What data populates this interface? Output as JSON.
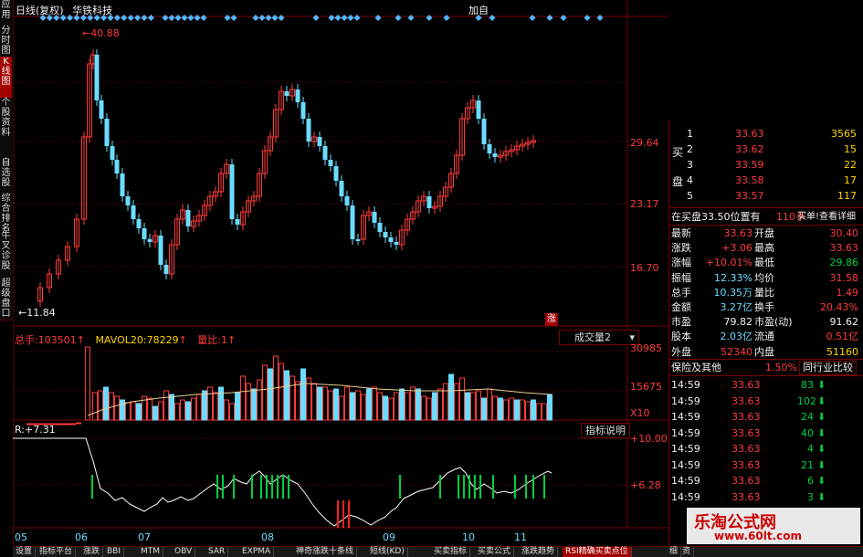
{
  "left_nav": [
    {
      "label": "应用",
      "active": false
    },
    {
      "label": "分时图",
      "active": false
    },
    {
      "label": "K线图",
      "active": true
    },
    {
      "label": "个股资料",
      "active": false
    },
    {
      "label": "自选股",
      "active": false
    },
    {
      "label": "综合排名",
      "active": false
    },
    {
      "label": "牛叉诊股",
      "active": false
    },
    {
      "label": "超级盘口",
      "active": false
    }
  ],
  "chart_header": {
    "period_label": "日线(复权)",
    "stock_name": "华铁科技",
    "right_label": "加自"
  },
  "price_panel": {
    "high_marker": "40.88",
    "low_marker": "11.84",
    "axis_ticks": [
      "29.64",
      "23.17",
      "16.70"
    ]
  },
  "volume_panel": {
    "total_label": "总手:",
    "total_value": "103501",
    "mavol_label": "MAVOL20:",
    "mavol_value": "78229",
    "ratio_label": "量比:",
    "ratio_value": "1",
    "dropdown_value": "成交量2",
    "zhang_badge": "涨",
    "axis_ticks": [
      "30985",
      "15675"
    ],
    "axis_unit": "X10"
  },
  "indicator_panel": {
    "r_label": "R:",
    "r_value": "+7.31",
    "button_label": "指标说明",
    "axis_ticks": [
      "+10.00",
      "+6.28"
    ]
  },
  "x_axis_months": [
    "05",
    "06",
    "07",
    "08",
    "09",
    "10",
    "11"
  ],
  "order_book": {
    "buy_label_1": "买",
    "buy_label_2": "盘",
    "levels": [
      {
        "level": "1",
        "price": "33.63",
        "volume": "3565"
      },
      {
        "level": "2",
        "price": "33.62",
        "volume": "15"
      },
      {
        "level": "3",
        "price": "33.59",
        "volume": "22"
      },
      {
        "level": "4",
        "price": "33.58",
        "volume": "17"
      },
      {
        "level": "5",
        "price": "33.57",
        "volume": "117"
      }
    ],
    "status_text": "在买盘33.50位置有",
    "status_count": "110手",
    "status_link": "买单!查看详细"
  },
  "quote": [
    {
      "l1": "最新",
      "v1": "33.63",
      "l2": "开盘",
      "v2": "30.40"
    },
    {
      "l1": "涨跌",
      "v1": "+3.06",
      "l2": "最高",
      "v2": "33.63"
    },
    {
      "l1": "涨幅",
      "v1": "+10.01%",
      "l2": "最低",
      "v2": "29.86"
    },
    {
      "l1": "振幅",
      "v1": "12.33%",
      "l2": "均价",
      "v2": "31.58"
    },
    {
      "l1": "总手",
      "v1": "10.35万",
      "l2": "量比",
      "v2": "1.49"
    },
    {
      "l1": "金额",
      "v1": "3.27亿",
      "l2": "换手",
      "v2": "20.43%"
    },
    {
      "l1": "市盈",
      "v1": "79.82",
      "l2": "市盈(动)",
      "v2": "91.62"
    },
    {
      "l1": "股本",
      "v1": "2.03亿",
      "l2": "流通",
      "v2": "0.51亿"
    },
    {
      "l1": "外盘",
      "v1": "52340",
      "l2": "内盘",
      "v2": "51160"
    }
  ],
  "industry": {
    "name": "保险及其他",
    "change": "1.50%",
    "button": "同行业比较"
  },
  "trades": [
    {
      "time": "14:59",
      "price": "33.63",
      "volume": "83"
    },
    {
      "time": "14:59",
      "price": "33.63",
      "volume": "102"
    },
    {
      "time": "14:59",
      "price": "33.63",
      "volume": "24"
    },
    {
      "time": "14:59",
      "price": "33.63",
      "volume": "40"
    },
    {
      "time": "14:59",
      "price": "33.63",
      "volume": "4"
    },
    {
      "time": "14:59",
      "price": "33.63",
      "volume": "21"
    },
    {
      "time": "14:59",
      "price": "33.63",
      "volume": "6"
    },
    {
      "time": "14:59",
      "price": "33.63",
      "volume": "3"
    }
  ],
  "bottom_tabs": [
    "设置",
    "指标平台",
    "涨跌",
    "BBI",
    "MTM",
    "OBV",
    "SAR",
    "EXPMA",
    "神奇涨跌十条线",
    "短线(KD)",
    "买卖指标",
    "买卖公式",
    "涨跌趋势",
    "RSI精确买卖点位"
  ],
  "bottom_right_labels": [
    "细",
    "资"
  ],
  "watermark": {
    "title": "乐淘公式网",
    "url": "www.60lt.com"
  },
  "colors": {
    "up": "#ff3b3b",
    "down": "#6bdcff",
    "mavol": "#e8d090",
    "rsi_line": "#ffffff",
    "signal_green": "#00d040",
    "signal_red": "#ff2020",
    "marker_blue": "#4fb7ff",
    "border": "#7a0000"
  }
}
